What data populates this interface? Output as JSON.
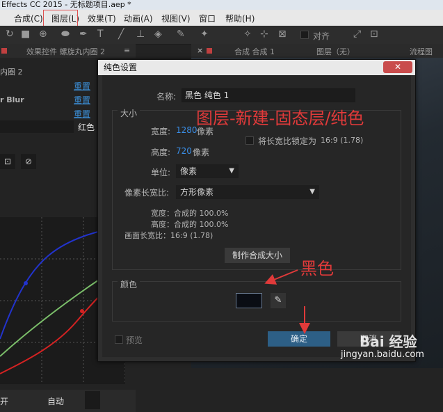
{
  "window": {
    "title": "Effects CC 2015 - 无标题项目.aep *"
  },
  "menu": {
    "items": [
      "合成(C)",
      "图层(L)",
      "效果(T)",
      "动画(A)",
      "视图(V)",
      "窗口",
      "帮助(H)"
    ]
  },
  "toolbar": {
    "snap_label": "对齐"
  },
  "left_panel": {
    "tab_title": "效果控件 螺旋丸内圈 2",
    "layer_name": "内圈 2",
    "effect_name": "r Blur",
    "reset_labels": [
      "重置",
      "重置",
      "重置"
    ],
    "color_value": "红色",
    "auto_label": "自动",
    "bottom_left_label": "开"
  },
  "right_panel": {
    "comp_tab": "合成 合成 1",
    "layer_tab": "图层（无）",
    "flowchart_tab": "流程图"
  },
  "dialog": {
    "title": "纯色设置",
    "name_label": "名称:",
    "name_value": "黑色 纯色 1",
    "size_section": "大小",
    "width_label": "宽度:",
    "width_value": "1280",
    "width_unit": "像素",
    "height_label": "高度:",
    "height_value": "720",
    "height_unit": "像素",
    "lock_ratio_label": "将长宽比锁定为",
    "lock_ratio_value": "16:9 (1.78)",
    "units_label": "单位:",
    "units_value": "像素",
    "pixel_aspect_label": "像素长宽比:",
    "pixel_aspect_value": "方形像素",
    "info_width": "宽度：合成的 100.0%",
    "info_height": "高度：合成的 100.0%",
    "info_frame": "画面长宽比：16:9 (1.78)",
    "make_comp_size": "制作合成大小",
    "color_section": "颜色",
    "swatch_color": "#0a0d14",
    "preview_label": "预览",
    "ok_label": "确定",
    "cancel_label": "取消"
  },
  "annotations": {
    "top": "图层-新建-固态层/纯色",
    "middle": "黑色"
  },
  "watermark": {
    "brand": "Bai 经验",
    "url": "jingyan.baidu.com"
  },
  "chart_data": {
    "type": "line",
    "series": [
      {
        "color": "#2233cc"
      },
      {
        "color": "#7bbf6a"
      },
      {
        "color": "#d42222"
      }
    ]
  },
  "colors": {
    "accent_red": "#e03a3a",
    "link_blue": "#3b8fd8",
    "ok_button": "#2d5f86"
  }
}
